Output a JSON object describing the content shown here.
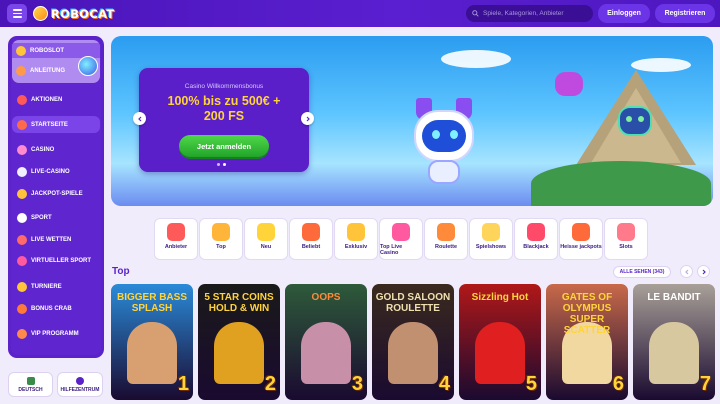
{
  "header": {
    "logo_text": "ROBOCAT",
    "search_placeholder": "Spiele, Kategorien, Anbieter",
    "login_label": "Einloggen",
    "register_label": "Registrieren",
    "accent": "#5a1fd0"
  },
  "sidebar": {
    "promo": [
      "ROBOSLOT",
      "ANLEITUNG"
    ],
    "items": [
      {
        "label": "AKTIONEN",
        "icon": "gift-icon",
        "color": "#ff5a5a"
      },
      {
        "label": "STARTSEITE",
        "icon": "home-icon",
        "color": "#ff6a4a"
      },
      {
        "label": "CASINO",
        "icon": "casino-icon",
        "color": "#ff8ad0"
      },
      {
        "label": "LIVE-CASINO",
        "icon": "cards-icon",
        "color": "#f0f0ff"
      },
      {
        "label": "JACKPOT-SPIELE",
        "icon": "jackpot-icon",
        "color": "#ffc43a"
      },
      {
        "label": "SPORT",
        "icon": "ball-icon",
        "color": "#ffffff"
      },
      {
        "label": "LIVE WETTEN",
        "icon": "live-bet-icon",
        "color": "#ff6a6a"
      },
      {
        "label": "VIRTUELLER SPORT",
        "icon": "virtual-sport-icon",
        "color": "#ff5aa0"
      },
      {
        "label": "TURNIERE",
        "icon": "trophy-icon",
        "color": "#ffc43a"
      },
      {
        "label": "BONUS CRAB",
        "icon": "crab-icon",
        "color": "#ff7a3a"
      },
      {
        "label": "VIP PROGRAMM",
        "icon": "vip-icon",
        "color": "#ff8a4a"
      }
    ],
    "active_index": 1,
    "footer": {
      "language": "DEUTSCH",
      "help": "HILFEZENTRUM"
    }
  },
  "banner": {
    "kicker": "Casino Willkommensbonus",
    "headline_1": "100% bis zu 500€ +",
    "headline_2": "200 FS",
    "cta": "Jetzt anmelden"
  },
  "categories": [
    {
      "label": "Anbieter",
      "color": "#ff5a5a"
    },
    {
      "label": "Top",
      "color": "#ffb43a"
    },
    {
      "label": "Neu",
      "color": "#ffd43a"
    },
    {
      "label": "Beliebt",
      "color": "#ff6a3a"
    },
    {
      "label": "Exklusiv",
      "color": "#ffc43a"
    },
    {
      "label": "Top Live Casino",
      "color": "#ff5aa0"
    },
    {
      "label": "Roulette",
      "color": "#ff8a3a"
    },
    {
      "label": "Spielshows",
      "color": "#ffd45a"
    },
    {
      "label": "Blackjack",
      "color": "#ff4a6a"
    },
    {
      "label": "Heisse jackpots",
      "color": "#ff6a3a"
    },
    {
      "label": "Slots",
      "color": "#ff7a8a"
    }
  ],
  "top": {
    "title": "Top",
    "see_all": "ALLE SEHEN (343)",
    "games": [
      {
        "title": "BIGGER BASS SPLASH",
        "rank": "1",
        "bg": "#2a8ad8",
        "fg": "#ffd43a",
        "art": "#d8a070"
      },
      {
        "title": "5 STAR COINS HOLD & WIN",
        "rank": "2",
        "bg": "#1a1a1a",
        "fg": "#ffd43a",
        "art": "#e0a020"
      },
      {
        "title": "OOPS",
        "rank": "3",
        "bg": "#2e5a3a",
        "fg": "#ff8a3a",
        "art": "#c890a8"
      },
      {
        "title": "GOLD SALOON ROULETTE",
        "rank": "4",
        "bg": "#3a2a1e",
        "fg": "#f0e0b0",
        "art": "#c09070"
      },
      {
        "title": "Sizzling Hot",
        "rank": "5",
        "bg": "#b01818",
        "fg": "#ffd43a",
        "art": "#e02020"
      },
      {
        "title": "GATES OF OLYMPUS SUPER SCATTER",
        "rank": "6",
        "bg": "#c86a4a",
        "fg": "#ffd43a",
        "art": "#f0d8a0"
      },
      {
        "title": "LE BANDIT",
        "rank": "7",
        "bg": "#a8a098",
        "fg": "#ffffff",
        "art": "#d8c8a0"
      }
    ]
  }
}
